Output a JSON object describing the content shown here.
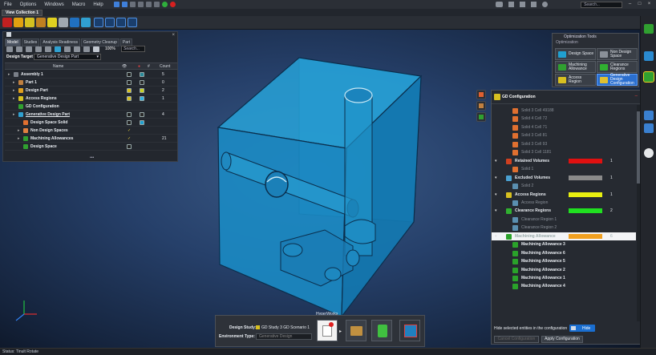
{
  "menubar": {
    "items": [
      "File",
      "Options",
      "Windows",
      "Macro",
      "Help"
    ],
    "search_placeholder": "Search..."
  },
  "view_tab": {
    "label": "View Collection 1"
  },
  "model_browser": {
    "tabs": [
      "Model",
      "Studies",
      "Analysis Readiness",
      "Geometry Cleanup",
      "Part"
    ],
    "zoom": "100%",
    "search_placeholder": "Search...",
    "design_target_label": "Design Target",
    "design_target_value": "Generative Design Part",
    "columns": {
      "name": "Name",
      "count": "Count"
    },
    "rows": [
      {
        "label": "Assembly 1",
        "count": "5",
        "indent": 0,
        "underline": false
      },
      {
        "label": "Part 1",
        "count": "0",
        "indent": 1,
        "underline": false
      },
      {
        "label": "Design Part",
        "count": "2",
        "indent": 1,
        "underline": false
      },
      {
        "label": "Access Regions",
        "count": "1",
        "indent": 1,
        "underline": false
      },
      {
        "label": "GD Configuration",
        "count": "",
        "indent": 1,
        "underline": false
      },
      {
        "label": "Generative Design Part",
        "count": "4",
        "indent": 1,
        "underline": true
      },
      {
        "label": "Design Space Solid",
        "count": "",
        "indent": 2,
        "underline": false
      },
      {
        "label": "Non Design Spaces",
        "count": "",
        "indent": 2,
        "underline": false
      },
      {
        "label": "Machining Allowances",
        "count": "21",
        "indent": 2,
        "underline": false
      },
      {
        "label": "Design Space",
        "count": "",
        "indent": 2,
        "underline": false
      }
    ]
  },
  "optimization_tools": {
    "title": "Optimization Tools",
    "section": "Optimization",
    "buttons": [
      "Design Space",
      "Non Design Space",
      "Machining Allowance",
      "Clearance Regions",
      "Access Region",
      "Generative Design Configuration"
    ]
  },
  "gd_config": {
    "title": "GD Configuration",
    "rows": [
      {
        "label": "Solid 3 Cell 49188",
        "type": "child"
      },
      {
        "label": "Solid 4 Cell 72",
        "type": "child"
      },
      {
        "label": "Solid 4 Cell 71",
        "type": "child"
      },
      {
        "label": "Solid 3 Cell 81",
        "type": "child"
      },
      {
        "label": "Solid 3 Cell 93",
        "type": "child"
      },
      {
        "label": "Solid 3 Cell 1181",
        "type": "child"
      },
      {
        "label": "Retained Volumes",
        "type": "group",
        "color": "#e01010",
        "count": "1"
      },
      {
        "label": "Solid 1",
        "type": "child"
      },
      {
        "label": "Excluded Volumes",
        "type": "group",
        "color": "#8a8a8a",
        "count": "1"
      },
      {
        "label": "Solid 2",
        "type": "child"
      },
      {
        "label": "Access Regions",
        "type": "group",
        "color": "#e8f010",
        "count": "1"
      },
      {
        "label": "Access Region",
        "type": "child"
      },
      {
        "label": "Clearance Regions",
        "type": "group",
        "color": "#20e020",
        "count": "2"
      },
      {
        "label": "Clearance Region 1",
        "type": "child"
      },
      {
        "label": "Clearance Region 2",
        "type": "child"
      },
      {
        "label": "Machining Allowance",
        "type": "group-hl",
        "color": "#f0a020",
        "count": "6"
      },
      {
        "label": "Machining Allowance 3",
        "type": "ma"
      },
      {
        "label": "Machining Allowance 6",
        "type": "ma"
      },
      {
        "label": "Machining Allowance 5",
        "type": "ma"
      },
      {
        "label": "Machining Allowance 2",
        "type": "ma"
      },
      {
        "label": "Machining Allowance 1",
        "type": "ma"
      },
      {
        "label": "Machining Allowance 4",
        "type": "ma"
      }
    ],
    "hide_label": "Hide selected entities in the configuration",
    "hide_toggle": "Hide",
    "left_button": "Cancel Configuration",
    "apply_button": "Apply Configuration"
  },
  "study_bar": {
    "tag": "HyperWorks",
    "study_label": "Design Study:",
    "study_value": "GD Study 3 GD Scenario 1",
    "env_label": "Environment Type:",
    "env_value": "Generative Design"
  },
  "status": {
    "text": "Status: Tinult Rotate"
  },
  "colors": {
    "model_blue": "#1d8fc9",
    "accent_blue": "#2b6fd0",
    "machining_green": "#2aa22a"
  }
}
